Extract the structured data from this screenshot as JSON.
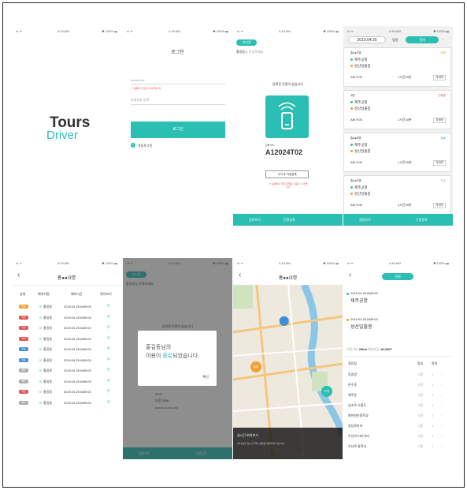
{
  "status": {
    "signal": "ııl ᯤ",
    "time": "4:19 AM",
    "battery": "✱ 100% ▬"
  },
  "splash": {
    "logo_line1": "Tours",
    "logo_line2": "Driver"
  },
  "login": {
    "title": "로그인",
    "id_value": "toursdrive",
    "error": "※ 등록되지 않은 아이디입니다",
    "pw_placeholder": "비밀번호 입력",
    "login_button": "로그인",
    "auto_login": "자동로그인"
  },
  "device": {
    "badge": "미지정",
    "greeting_name": "홍길동",
    "greeting_suffix": "님 안녕하세요.",
    "heading": "등록된 단말이 없습니다",
    "sn_label": "단말 S/N",
    "sn_value": "A12024T02",
    "register_button": "사직 후 자동등록",
    "warning": "※ 등록하지 않은 단말은 사용할 수 없습니다",
    "nav": [
      "일정보기",
      "단말등록"
    ]
  },
  "schedule": {
    "date": "2019.04.25",
    "filter_label": "일정",
    "filter_value": "전체",
    "nav": [
      "일정보기",
      "단말등록"
    ],
    "cards": [
      {
        "count": "홍●●/3명",
        "status": "예정",
        "from": "제주공항",
        "to": "성산일출봉",
        "time": "AM 9:00",
        "duration": "1시간20분",
        "detail": "자세히"
      },
      {
        "count": "3명",
        "status": "진행중",
        "from": "제주공항",
        "to": "성산일출봉",
        "time": "AM 9:00",
        "duration": "1시간20분",
        "detail": "자세히"
      },
      {
        "count": "홍●●/3명",
        "status": "완료",
        "from": "제주공항",
        "to": "성산일출봉",
        "time": "AM 9:00",
        "duration": "1시간20분",
        "detail": "자세히"
      },
      {
        "count": "홍●●/3명",
        "status": "취소",
        "from": "제주공항",
        "to": "성산일출봉",
        "time": "AM 9:00",
        "duration": "1시간20분",
        "detail": "자세히"
      }
    ]
  },
  "passengers": {
    "title": "홍●●/3명",
    "headers": [
      "상태",
      "예약자명",
      "예약시간",
      "위치보기"
    ],
    "rows": [
      {
        "status": "탑승",
        "color": "#f0a030",
        "name": "홍길동",
        "time": "2019.04.25 AM9:00"
      },
      {
        "status": "미탑",
        "color": "#e05050",
        "name": "홍길동",
        "time": "2019.04.25 AM9:00"
      },
      {
        "status": "미탑",
        "color": "#e05050",
        "name": "홍길동",
        "time": "2019.04.25 AM9:00"
      },
      {
        "status": "하차",
        "color": "#e05050",
        "name": "홍길동",
        "time": "2019.04.25 AM9:00"
      },
      {
        "status": "탑승",
        "color": "#3f8fd8",
        "name": "홍길동",
        "time": "2019.04.25 AM9:00"
      },
      {
        "status": "탑승",
        "color": "#3f8fd8",
        "name": "홍길동",
        "time": "2019.04.25 AM9:00"
      },
      {
        "status": "예약",
        "color": "#aaaaaa",
        "name": "홍길동",
        "time": "2019.04.25 AM9:00"
      },
      {
        "status": "예약",
        "color": "#aaaaaa",
        "name": "홍길동",
        "time": "2019.04.25 AM9:00"
      },
      {
        "status": "미탑",
        "color": "#e05050",
        "name": "홍길동",
        "time": "2019.04.25 AM9:00"
      },
      {
        "status": "예약",
        "color": "#aaaaaa",
        "name": "홍길동",
        "time": "2019.04.25 AM9:00"
      }
    ]
  },
  "dialog": {
    "badge": "미지정",
    "greeting": "홍길동님 안녕하세요.",
    "line1": "홍길동님의",
    "line2_pre": "이용이 ",
    "line2_hl": "종료",
    "line2_post": "되었습니다.",
    "confirm": "확인",
    "bg_heading": "등록된 차량이 없습니다",
    "bg_sn1": "3S4T",
    "bg_sn2": "단말 3456",
    "bg_date": "2019.04.12 AM 11:00",
    "nav": [
      "일정보기",
      "단말등록"
    ]
  },
  "map": {
    "title": "홍●●/3명",
    "pins": [
      "출발",
      "도착"
    ],
    "bottom_title": "실시간 위치보기",
    "bottom_text": "홍●●님은 실시간 위치 공유를 허용하지 않습니다."
  },
  "route": {
    "filter": "전체",
    "stop1_time": "2015.04.25 AM9:00",
    "stop1_name": "제주공항",
    "stop2_time": "2019.04.25 AM9:00",
    "stop2_name": "성산일출봉",
    "distance_label": "이동거리",
    "distance": "29km",
    "fare_label": "예상요금",
    "fare": "18,000T",
    "table_headers": [
      "정류장",
      "탑승",
      "하차"
    ],
    "stops": [
      "동광양",
      "한수동",
      "제주동",
      "삼조로 오름도",
      "화천한라중학교",
      "송당로타리",
      "우선리 터미거리",
      "우산로 통학교"
    ]
  }
}
